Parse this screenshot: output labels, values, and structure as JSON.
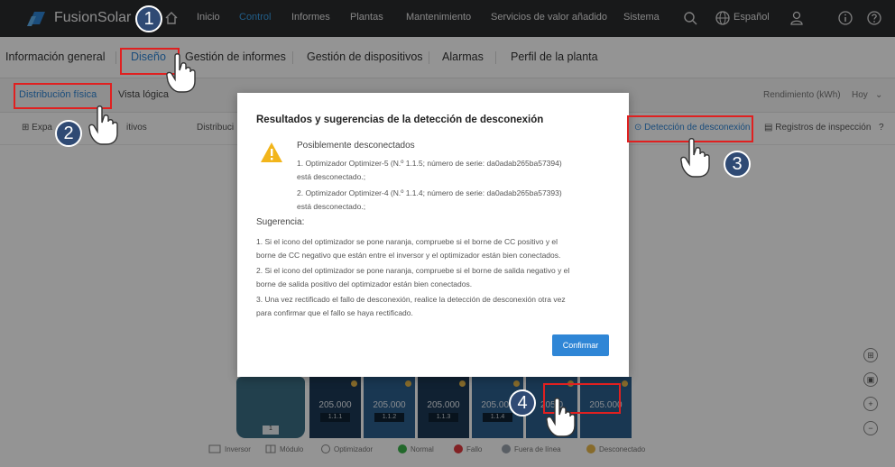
{
  "app": {
    "brand": "FusionSolar"
  },
  "topnav": {
    "items": [
      "Inicio",
      "Control",
      "Informes",
      "Plantas",
      "Mantenimiento",
      "Servicios de valor añadido",
      "Sistema"
    ],
    "active": "Control",
    "language": "Español"
  },
  "secondary_tabs": {
    "items": [
      "Información general",
      "Diseño",
      "Gestión de informes",
      "Gestión de dispositivos",
      "Alarmas",
      "Perfil de la planta"
    ],
    "active": "Diseño"
  },
  "view_tabs": {
    "items": [
      "Distribución física",
      "Vista lógica"
    ],
    "active": "Distribución física",
    "rendimiento_label": "Rendimiento (kWh)",
    "period": "Hoy"
  },
  "toolbar": {
    "expand_label": "Expa",
    "dispositivos_label": "itivos",
    "distribucion_label": "Distribuci",
    "detect_label": "Detección de desconexión",
    "records_label": "Registros de inspección"
  },
  "modal": {
    "title": "Resultados y sugerencias de la detección de desconexión",
    "subtitle": "Posiblemente desconectados",
    "disconnected": [
      "1. Optimizador Optimizer-5 (N.º 1.1.5; número de serie: da0adab265ba57394)",
      "está desconectado.;",
      "2. Optimizador Optimizer-4 (N.º 1.1.4; número de serie: da0adab265ba57393)",
      "está desconectado.;"
    ],
    "suggestion_title": "Sugerencia:",
    "suggestions": [
      "1. Si el icono del optimizador se pone naranja, compruebe si el borne de CC positivo y el",
      "borne de CC negativo que están entre el inversor y el optimizador están bien conectados.",
      "2. Si el icono del optimizador se pone naranja, compruebe si el borne de salida negativo y el",
      "borne de salida positivo del optimizador están bien conectados.",
      "3. Una vez rectificado el fallo de desconexión, realice la detección de desconexión otra vez",
      "para confirmar que el fallo se haya rectificado."
    ],
    "confirm_label": "Confirmar"
  },
  "devices": {
    "inverter_tag": "1",
    "optimizers": [
      {
        "value": "205.000",
        "id": "1.1.1"
      },
      {
        "value": "205.000",
        "id": "1.1.2"
      },
      {
        "value": "205.000",
        "id": "1.1.3"
      },
      {
        "value": "205.000",
        "id": "1.1.4"
      },
      {
        "value": "205.0",
        "id": ""
      },
      {
        "value": "205.000",
        "id": ""
      }
    ]
  },
  "legend": [
    "Inversor",
    "Módulo",
    "Optimizador",
    "Normal",
    "Fallo",
    "Fuera de línea",
    "Desconectado"
  ],
  "steps": [
    "1",
    "2",
    "3",
    "4"
  ],
  "colors": {
    "accent": "#2f86d6",
    "nav_bg": "#2a2b2e",
    "annotation": "#e02020",
    "badge": "#2f4a74"
  }
}
